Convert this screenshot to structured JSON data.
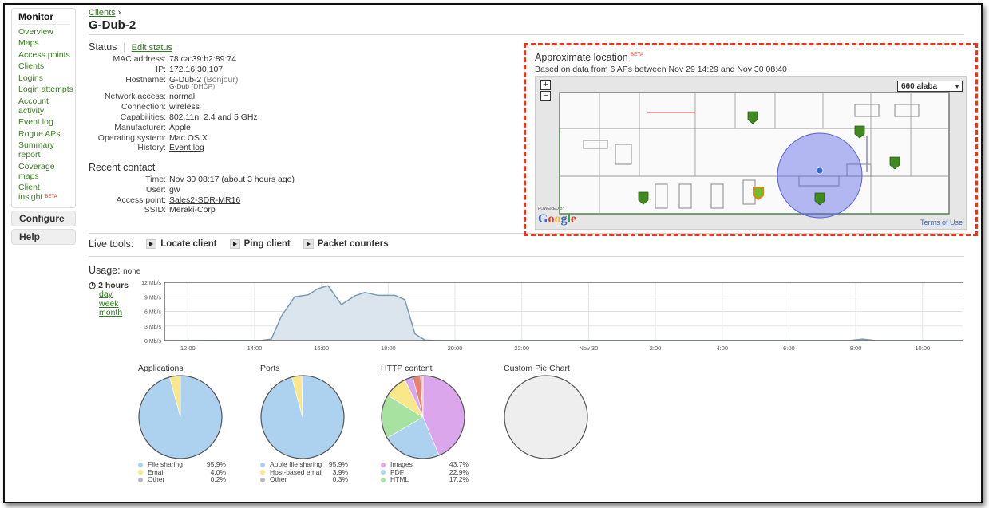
{
  "sidebar": {
    "header": "Monitor",
    "items": [
      {
        "label": "Overview"
      },
      {
        "label": "Maps"
      },
      {
        "label": "Access points"
      },
      {
        "label": "Clients"
      },
      {
        "label": "Logins"
      },
      {
        "label": "Login attempts"
      },
      {
        "label": "Account activity"
      },
      {
        "label": "Event log"
      },
      {
        "label": "Rogue APs"
      },
      {
        "label": "Summary report"
      },
      {
        "label": "Coverage maps"
      },
      {
        "label": "Client insight",
        "badge": "BETA"
      }
    ],
    "sections": [
      {
        "label": "Configure"
      },
      {
        "label": "Help"
      }
    ]
  },
  "breadcrumb": {
    "parent": "Clients",
    "separator": "›"
  },
  "page_title": "G-Dub-2",
  "status": {
    "title": "Status",
    "edit_link": "Edit status",
    "fields": [
      {
        "label": "MAC address:",
        "value": "78:ca:39:b2:89:74"
      },
      {
        "label": "IP:",
        "value": "172.16.30.107"
      },
      {
        "label": "Hostname:",
        "value": "G-Dub-2",
        "value_note": "(Bonjour)",
        "sub_value": "G-Dub",
        "sub_note": "(DHCP)"
      },
      {
        "label": "Network access:",
        "value": "normal"
      },
      {
        "label": "Connection:",
        "value": "wireless"
      },
      {
        "label": "Capabilities:",
        "value": "802.11n, 2.4 and 5 GHz"
      },
      {
        "label": "Manufacturer:",
        "value": "Apple"
      },
      {
        "label": "Operating system:",
        "value": "Mac OS X"
      },
      {
        "label": "History:",
        "value": "Event log"
      }
    ]
  },
  "recent_contact": {
    "title": "Recent contact",
    "fields": [
      {
        "label": "Time:",
        "value": "Nov 30 08:17 (about 3 hours ago)"
      },
      {
        "label": "User:",
        "value": "gw"
      },
      {
        "label": "Access point:",
        "value": "Sales2-SDR-MR16"
      },
      {
        "label": "SSID:",
        "value": "Meraki-Corp"
      }
    ]
  },
  "live_tools": {
    "label": "Live tools:",
    "buttons": [
      {
        "label": "Locate client"
      },
      {
        "label": "Ping client"
      },
      {
        "label": "Packet counters"
      }
    ]
  },
  "location": {
    "title": "Approximate location",
    "badge": "BETA",
    "subtitle": "Based on data from 6 APs between Nov 29 14:29 and Nov 30 08:40",
    "zoom_in": "+",
    "zoom_out": "−",
    "floor_select": "660 alaba",
    "powered_by": "POWERED BY",
    "google": [
      "G",
      "o",
      "o",
      "g",
      "l",
      "e"
    ],
    "google_colors": [
      "#3b67c6",
      "#d8392b",
      "#f0b31c",
      "#3b67c6",
      "#3c9a3e",
      "#d8392b"
    ],
    "terms": "Terms of Use",
    "accent_color": "#e03a1e"
  },
  "usage": {
    "label": "Usage:",
    "value": "none",
    "range_selected": "2 hours",
    "range_links": [
      "day",
      "week",
      "month"
    ]
  },
  "chart_data": [
    {
      "type": "area",
      "title": "Usage",
      "ylabel": "Mb/s",
      "ylim": [
        0,
        12
      ],
      "yticks": [
        "0 Mb/s",
        "3 Mb/s",
        "6 Mb/s",
        "9 Mb/s",
        "12 Mb/s"
      ],
      "ytick_values": [
        0,
        3,
        6,
        9,
        12
      ],
      "xlim_hours": [
        11.3,
        35.2
      ],
      "xticks": [
        {
          "label": "12:00",
          "h": 12
        },
        {
          "label": "14:00",
          "h": 14
        },
        {
          "label": "16:00",
          "h": 16
        },
        {
          "label": "18:00",
          "h": 18
        },
        {
          "label": "20:00",
          "h": 20
        },
        {
          "label": "22:00",
          "h": 22
        },
        {
          "label": "Nov 30",
          "h": 24
        },
        {
          "label": "2:00",
          "h": 26
        },
        {
          "label": "4:00",
          "h": 28
        },
        {
          "label": "6:00",
          "h": 30
        },
        {
          "label": "8:00",
          "h": 32
        },
        {
          "label": "10:00",
          "h": 34
        }
      ],
      "grid": true,
      "series": [
        {
          "name": "Usage",
          "x_hours": [
            11.3,
            14.2,
            14.5,
            14.8,
            15.2,
            15.6,
            15.9,
            16.2,
            16.6,
            17.0,
            17.3,
            17.7,
            18.2,
            18.5,
            18.8,
            19.1,
            19.5,
            31.8,
            32.2,
            32.6,
            35.2
          ],
          "values": [
            0,
            0.05,
            0.3,
            5.0,
            9.0,
            9.4,
            10.7,
            11.3,
            7.4,
            9.2,
            9.9,
            9.3,
            9.3,
            8.4,
            1.4,
            0.1,
            0,
            0,
            0.3,
            0,
            0
          ]
        }
      ]
    },
    {
      "type": "pie",
      "title": "Applications",
      "slices": [
        {
          "label": "File sharing",
          "value": 95.9,
          "display": "95.9%",
          "color": "#acd2ef"
        },
        {
          "label": "Email",
          "value": 4.0,
          "display": "4.0%",
          "color": "#f8e88a"
        },
        {
          "label": "Other",
          "value": 0.2,
          "display": "0.2%",
          "color": "#b8b8c8"
        }
      ]
    },
    {
      "type": "pie",
      "title": "Ports",
      "slices": [
        {
          "label": "Apple file sharing",
          "value": 95.9,
          "display": "95.9%",
          "color": "#acd2ef"
        },
        {
          "label": "Host-based email",
          "value": 3.9,
          "display": "3.9%",
          "color": "#f8e88a"
        },
        {
          "label": "Other",
          "value": 0.3,
          "display": "0.3%",
          "color": "#b8b8c8"
        }
      ]
    },
    {
      "type": "pie",
      "title": "HTTP content",
      "slices": [
        {
          "label": "Images",
          "value": 43.7,
          "display": "43.7%",
          "color": "#dca6ec",
          "legend": true
        },
        {
          "label": "PDF",
          "value": 22.9,
          "display": "22.9%",
          "color": "#acd2ef",
          "legend": true
        },
        {
          "label": "HTML",
          "value": 17.2,
          "display": "17.2%",
          "color": "#a8e2a0",
          "legend": true
        },
        {
          "label": "Other (yellow)",
          "value": 9.0,
          "color": "#f8e88a",
          "legend": false
        },
        {
          "label": "Other (violet)",
          "value": 3.2,
          "color": "#d7a9ee",
          "legend": false
        },
        {
          "label": "Other (red)",
          "value": 3.0,
          "color": "#e8806e",
          "legend": false
        },
        {
          "label": "Other (pink)",
          "value": 1.0,
          "color": "#f4c2c2",
          "legend": false
        }
      ]
    },
    {
      "type": "pie",
      "title": "Custom Pie Chart",
      "slices": [],
      "empty_color": "#eeeeee"
    }
  ]
}
